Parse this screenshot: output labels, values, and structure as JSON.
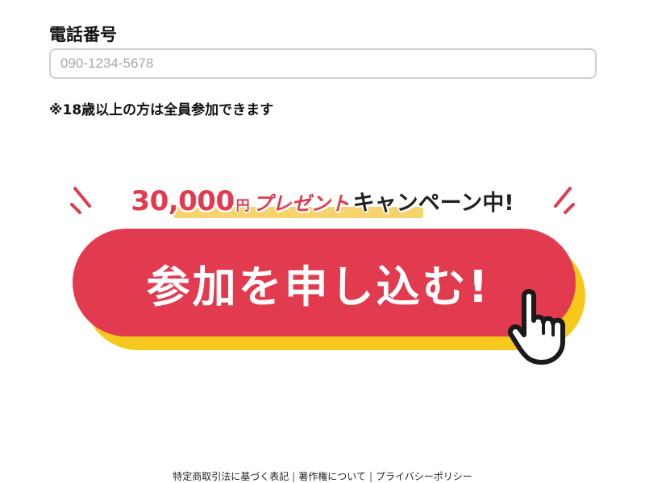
{
  "form": {
    "phone_label": "電話番号",
    "phone_placeholder": "090-1234-5678",
    "phone_value": "",
    "note": "※18歳以上の方は全員参加できます"
  },
  "banner": {
    "amount": "30,000",
    "currency": "円",
    "present": "プレゼント",
    "campaign": "キャンペーン中!"
  },
  "cta": {
    "label": "参加を申し込む!"
  },
  "footer": {
    "links": [
      "特定商取引法に基づく表記",
      "著作権について",
      "プライバシーポリシー"
    ],
    "separator": "|"
  },
  "colors": {
    "accent_red": "#e23a4f",
    "button_shadow_yellow": "#f7c81c",
    "highlight_yellow": "#f6d36b"
  },
  "icons": {
    "sparkle": "sparkle-lines-icon",
    "cursor": "pointing-hand-icon"
  }
}
